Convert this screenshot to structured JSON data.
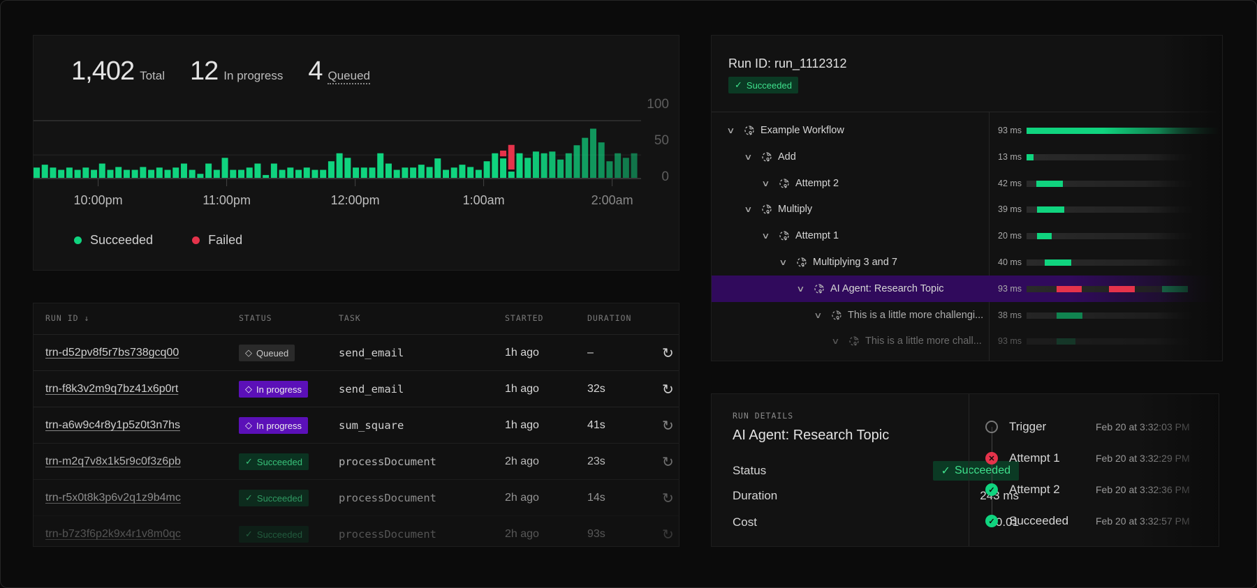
{
  "stats": [
    {
      "value": "1,402",
      "label": "Total"
    },
    {
      "value": "12",
      "label": "In progress"
    },
    {
      "value": "4",
      "label": "Queued"
    }
  ],
  "colors": {
    "succeeded": "#10d47f",
    "failed": "#e5334b",
    "in_progress": "#5b10b8",
    "highlight": "#300a5c"
  },
  "chart_data": {
    "type": "bar",
    "stacked": true,
    "title": "",
    "xlabel": "",
    "ylabel": "",
    "ylim": [
      0,
      100
    ],
    "y_ticks": [
      "100",
      "50",
      "0"
    ],
    "x_ticks": [
      {
        "label": "10:00pm",
        "at_bar": 7.9
      },
      {
        "label": "11:00pm",
        "at_bar": 23.6
      },
      {
        "label": "12:00pm",
        "at_bar": 39.3
      },
      {
        "label": "1:00am",
        "at_bar": 55.0
      },
      {
        "label": "2:00am",
        "at_bar": 70.7
      }
    ],
    "legend": {
      "position": "bottom-left",
      "items": [
        "Succeeded",
        "Failed"
      ]
    },
    "series": [
      {
        "name": "Succeeded",
        "values": [
          18,
          23,
          18,
          14,
          18,
          14,
          18,
          14,
          25,
          14,
          19,
          14,
          14,
          19,
          14,
          18,
          14,
          18,
          25,
          14,
          7,
          25,
          14,
          35,
          14,
          14,
          18,
          25,
          5,
          25,
          14,
          18,
          14,
          18,
          14,
          14,
          29,
          43,
          35,
          18,
          18,
          18,
          43,
          25,
          14,
          18,
          18,
          23,
          19,
          34,
          14,
          18,
          23,
          19,
          14,
          29,
          43,
          34,
          11,
          43,
          35,
          46,
          43,
          46,
          32,
          43,
          57,
          70,
          86,
          62,
          29,
          43,
          35,
          43
        ]
      },
      {
        "name": "Failed",
        "values": [
          0,
          0,
          0,
          0,
          0,
          0,
          0,
          0,
          0,
          0,
          0,
          0,
          0,
          0,
          0,
          0,
          0,
          0,
          0,
          0,
          0,
          0,
          0,
          0,
          0,
          0,
          0,
          0,
          0,
          0,
          0,
          0,
          0,
          0,
          0,
          0,
          0,
          0,
          0,
          0,
          0,
          0,
          0,
          0,
          0,
          0,
          0,
          0,
          0,
          0,
          0,
          0,
          0,
          0,
          0,
          0,
          0,
          10,
          43,
          0,
          0,
          0,
          0,
          0,
          0,
          0,
          0,
          0,
          0,
          0,
          0,
          0,
          0,
          0
        ]
      }
    ]
  },
  "table": {
    "headers": [
      "RUN ID",
      "STATUS",
      "TASK",
      "STARTED",
      "DURATION"
    ],
    "sort_icon": "arrow-down-icon",
    "rows": [
      {
        "id": "trn-d52pv8f5r7bs738gcq00",
        "status": "Queued",
        "kind": "queued",
        "task": "send_email",
        "started": "1h ago",
        "duration": "–"
      },
      {
        "id": "trn-f8k3v2m9q7bz41x6p0rt",
        "status": "In progress",
        "kind": "prog",
        "task": "send_email",
        "started": "1h ago",
        "duration": "32s"
      },
      {
        "id": "trn-a6w9c4r8y1p5z0t3n7hs",
        "status": "In progress",
        "kind": "prog",
        "task": "sum_square",
        "started": "1h ago",
        "duration": "41s"
      },
      {
        "id": "trn-m2q7v8x1k5r9c0f3z6pb",
        "status": "Succeeded",
        "kind": "succ",
        "task": "processDocument",
        "started": "2h ago",
        "duration": "23s"
      },
      {
        "id": "trn-r5x0t8k3p6v2q1z9b4mc",
        "status": "Succeeded",
        "kind": "succ",
        "task": "processDocument",
        "started": "2h ago",
        "duration": "14s"
      },
      {
        "id": "trn-b7z3f6p2k9x4r1v8m0qc",
        "status": "Succeeded",
        "kind": "succ",
        "task": "processDocument",
        "started": "2h ago",
        "duration": "93s"
      }
    ]
  },
  "run": {
    "title": "Run ID: run_1112312",
    "status": "Succeeded",
    "tree": [
      {
        "label": "Example Workflow",
        "depth": 0,
        "duration": "93 ms"
      },
      {
        "label": "Add",
        "depth": 1,
        "duration": "13 ms"
      },
      {
        "label": "Attempt 2",
        "depth": 2,
        "duration": "42 ms"
      },
      {
        "label": "Multiply",
        "depth": 1,
        "duration": "39 ms"
      },
      {
        "label": "Attempt 1",
        "depth": 2,
        "duration": "20 ms"
      },
      {
        "label": "Multiplying 3 and 7",
        "depth": 3,
        "duration": "40 ms"
      },
      {
        "label": "AI Agent: Research Topic",
        "depth": 4,
        "duration": "93 ms",
        "selected": true
      },
      {
        "label": "This is a little more challengi...",
        "depth": 5,
        "duration": "38 ms"
      },
      {
        "label": "This is a little more chall...",
        "depth": 6,
        "duration": "93 ms"
      }
    ]
  },
  "details": {
    "section_label": "RUN DETAILS",
    "title": "AI Agent: Research Topic",
    "fields": [
      {
        "key": "Status",
        "value": "Succeeded"
      },
      {
        "key": "Duration",
        "value": "243 ms"
      },
      {
        "key": "Cost",
        "value": "$0.01"
      }
    ],
    "timeline": [
      {
        "label": "Trigger",
        "date": "Feb 20  at 3:32:03 PM",
        "state": "pending"
      },
      {
        "label": "Attempt 1",
        "date": "Feb 20 at 3:32:29 PM",
        "state": "failed"
      },
      {
        "label": "Attempt 2",
        "date": "Feb 20 at 3:32:36 PM",
        "state": "succeeded"
      },
      {
        "label": "Succeeded",
        "date": "Feb 20 at 3:32:57 PM",
        "state": "succeeded"
      }
    ]
  }
}
